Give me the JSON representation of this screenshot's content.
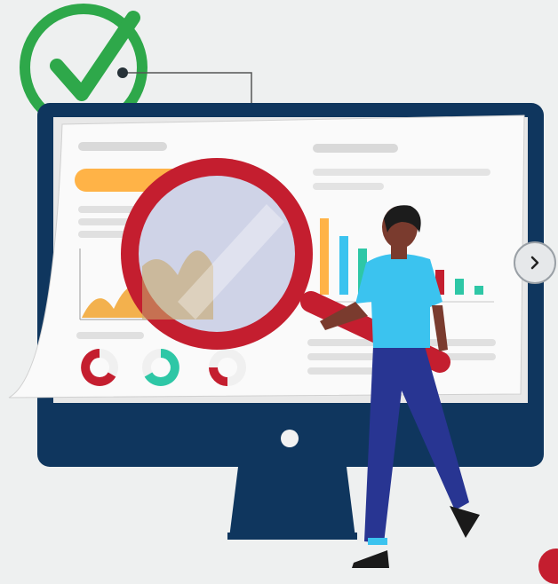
{
  "illustration": {
    "subject": "",
    "colors": {
      "monitor_frame": "#0f365e",
      "screen_paper": "#f7f7f7",
      "accent_red": "#c41e2f",
      "check_green": "#2ea84a",
      "highlight_orange": "#ffb347",
      "teal": "#2ec7a6",
      "shirt_blue": "#3bc3ef",
      "pants_navy": "#283592"
    },
    "icons": [
      "check-icon",
      "magnifier-icon",
      "chevron-right-icon"
    ]
  },
  "carousel": {
    "next_icon": "chevron-right-icon"
  }
}
